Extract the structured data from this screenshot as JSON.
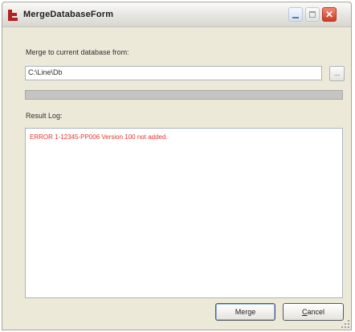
{
  "window": {
    "title": "MergeDatabaseForm",
    "close_glyph": "✕"
  },
  "form": {
    "merge_label": "Merge to current database from:",
    "path_value": "C:\\Line\\Db",
    "browse_label": "...",
    "progress_fraction": 0,
    "log_label": "Result Log:",
    "log_lines": [
      "ERROR 1-12345-PP006 Version 100 not added."
    ]
  },
  "buttons": {
    "merge_label": "Merge",
    "cancel_first": "C",
    "cancel_rest": "ancel"
  },
  "colors": {
    "error_text": "#e8342c",
    "titlebar": "#e6e5e0",
    "window_bg": "#ece9d8"
  },
  "icons": {
    "app": "app-logo-icon",
    "minimize": "minimize-icon",
    "maximize": "maximize-icon",
    "close": "close-icon",
    "resize": "resize-grip-icon"
  }
}
